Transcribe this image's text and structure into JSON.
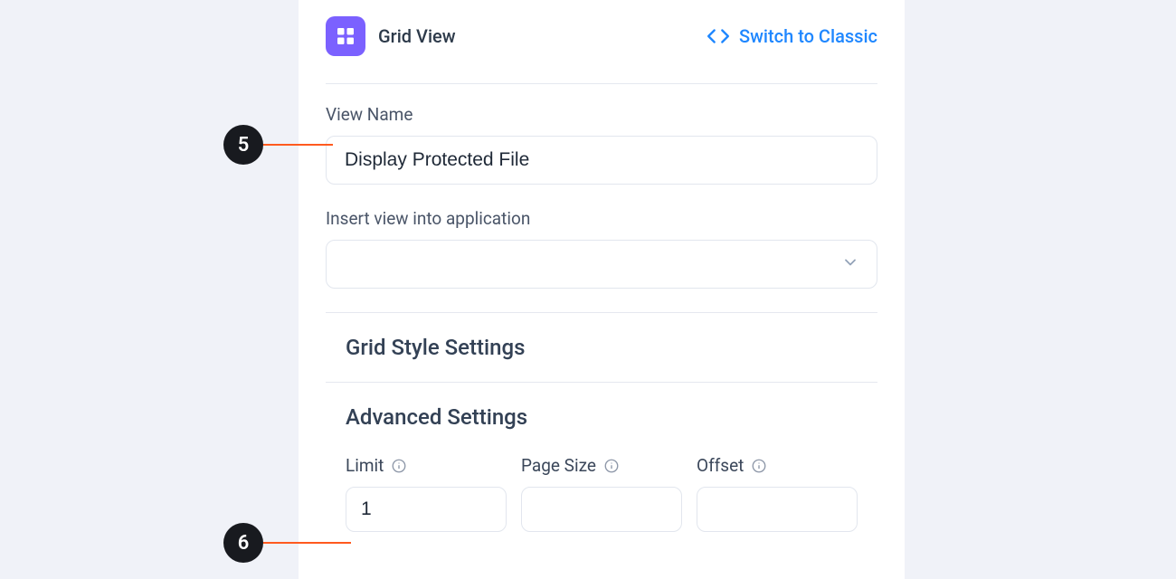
{
  "header": {
    "title": "Grid View",
    "switch_label": "Switch to Classic"
  },
  "view_name": {
    "label": "View Name",
    "value": "Display Protected File"
  },
  "insert_view": {
    "label": "Insert view into application",
    "value": ""
  },
  "sections": {
    "grid_style": "Grid Style Settings",
    "advanced": "Advanced Settings"
  },
  "advanced_fields": {
    "limit": {
      "label": "Limit",
      "value": "1"
    },
    "page_size": {
      "label": "Page Size",
      "value": ""
    },
    "offset": {
      "label": "Offset",
      "value": ""
    }
  },
  "callouts": {
    "b5": "5",
    "b6": "6"
  }
}
